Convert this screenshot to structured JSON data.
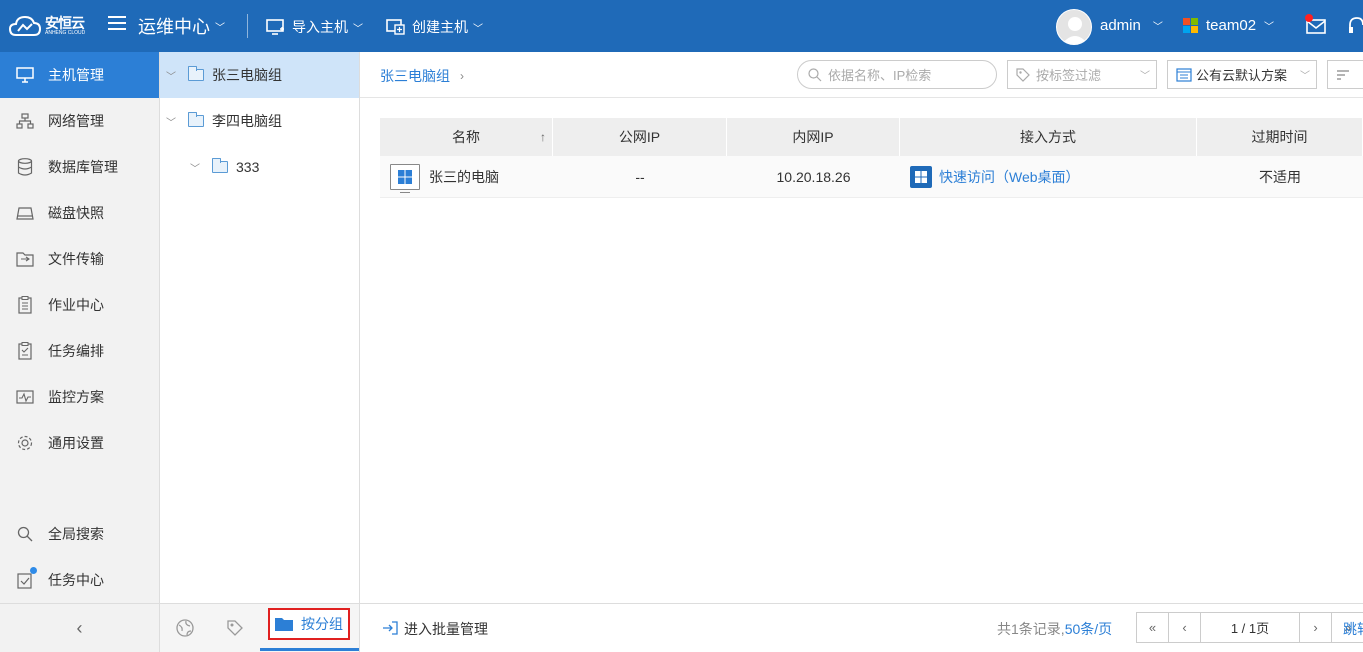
{
  "topbar": {
    "logo_text": "安恒云",
    "logo_sub": "ANHENG CLOUD",
    "center_title": "运维中心",
    "import_label": "导入主机",
    "create_label": "创建主机",
    "user_name": "admin",
    "team_name": "team02"
  },
  "sidebar": {
    "items": [
      {
        "label": "主机管理",
        "icon": "monitor-icon"
      },
      {
        "label": "网络管理",
        "icon": "network-icon"
      },
      {
        "label": "数据库管理",
        "icon": "database-icon"
      },
      {
        "label": "磁盘快照",
        "icon": "disk-icon"
      },
      {
        "label": "文件传输",
        "icon": "file-transfer-icon"
      },
      {
        "label": "作业中心",
        "icon": "job-icon"
      },
      {
        "label": "任务编排",
        "icon": "task-orchestration-icon"
      },
      {
        "label": "监控方案",
        "icon": "monitor-chart-icon"
      },
      {
        "label": "通用设置",
        "icon": "gear-icon"
      }
    ],
    "search_label": "全局搜索",
    "task_center_label": "任务中心"
  },
  "tree": {
    "nodes": [
      {
        "label": "张三电脑组"
      },
      {
        "label": "李四电脑组"
      },
      {
        "label": "333"
      }
    ],
    "group_tab_label": "按分组"
  },
  "main": {
    "breadcrumb": "张三电脑组",
    "search_placeholder": "依据名称、IP检索",
    "tag_filter_placeholder": "按标签过滤",
    "plan_label": "公有云默认方案",
    "columns": [
      "名称",
      "公网IP",
      "内网IP",
      "接入方式",
      "过期时间"
    ],
    "rows": [
      {
        "name": "张三的电脑",
        "public_ip": "--",
        "private_ip": "10.20.18.26",
        "access": "快速访问（Web桌面）",
        "expire": "不适用"
      }
    ],
    "batch_label": "进入批量管理",
    "total_text": "共1条记录,",
    "per_page": "50条/页",
    "page_info": "1 / 1页",
    "jump_label": "跳转"
  },
  "colors": {
    "brand": "#1f6ab8",
    "active": "#2c7fd6",
    "highlight_border": "#e02020"
  }
}
